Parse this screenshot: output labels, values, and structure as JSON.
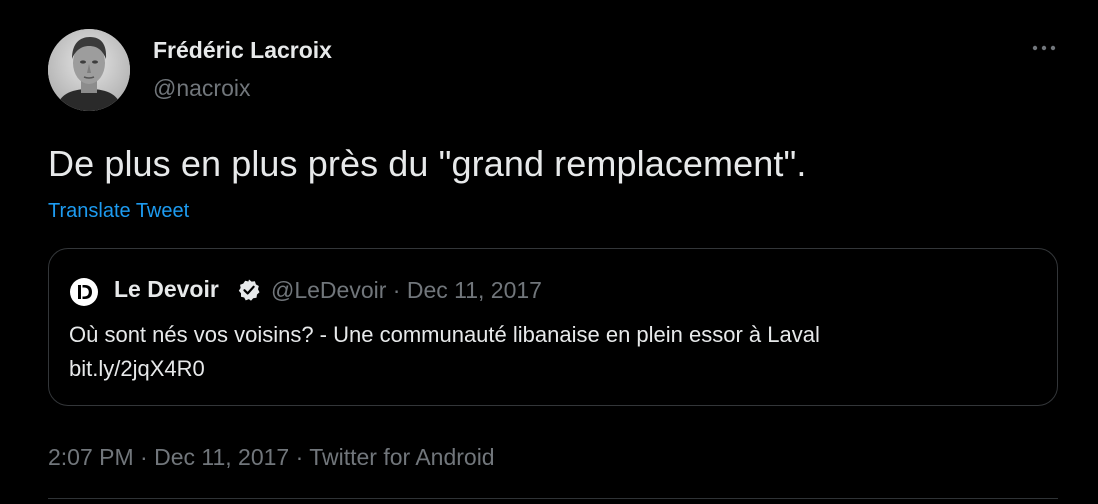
{
  "author": {
    "name": "Frédéric Lacroix",
    "handle": "@nacroix"
  },
  "more_icon": "more-horizontal-icon",
  "tweet": {
    "text": "De plus en plus près du \"grand remplacement\".",
    "translate_label": "Translate Tweet"
  },
  "quote": {
    "logo_icon": "le-devoir-logo-icon",
    "name": "Le Devoir",
    "verified_icon": "verified-badge-icon",
    "meta": "@LeDevoir · Dec 11, 2017",
    "text_line1": "Où sont nés vos voisins? - Une communauté libanaise en plein essor à Laval",
    "text_line2": "bit.ly/2jqX4R0"
  },
  "timestamp": "2:07 PM · Dec 11, 2017 · Twitter for Android",
  "colors": {
    "background": "#000000",
    "primary_text": "#e7e9ea",
    "secondary_text": "#71767b",
    "link": "#1d9bf0",
    "border": "#333639"
  }
}
